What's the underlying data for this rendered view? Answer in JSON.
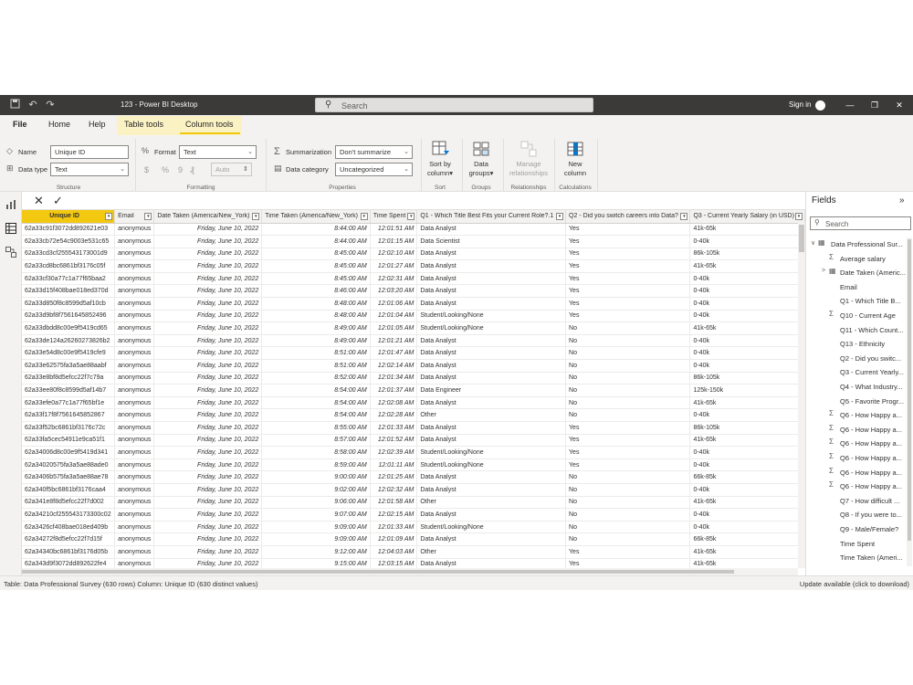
{
  "window": {
    "title": "123 - Power BI Desktop",
    "search_placeholder": "Search",
    "sign_in": "Sign in"
  },
  "menu": {
    "tabs": [
      "File",
      "Home",
      "Help",
      "Table tools",
      "Column tools"
    ],
    "active_tab": "Column tools",
    "accent_color": "#f2c811"
  },
  "ribbon": {
    "structure": {
      "name_label": "Name",
      "name_value": "Unique ID",
      "datatype_label": "Data type",
      "datatype_value": "Text",
      "group": "Structure"
    },
    "formatting": {
      "format_label": "Format",
      "format_value": "Text",
      "symbols": [
        "$",
        "%",
        "9",
        "₰"
      ],
      "auto_value": "Auto",
      "group": "Formatting"
    },
    "properties": {
      "summarization_label": "Summarization",
      "summarization_value": "Don't summarize",
      "category_label": "Data category",
      "category_value": "Uncategorized",
      "group": "Properties"
    },
    "sort": {
      "label": "Sort by column",
      "line1": "Sort by",
      "line2": "column",
      "group": "Sort"
    },
    "groups": {
      "line1": "Data",
      "line2": "groups",
      "group": "Groups"
    },
    "relationships": {
      "line1": "Manage",
      "line2": "relationships",
      "group": "Relationships"
    },
    "calculations": {
      "line1": "New",
      "line2": "column",
      "group": "Calculations"
    }
  },
  "table": {
    "columns": [
      "Unique ID",
      "Email",
      "Date Taken (America/New_York)",
      "Time Taken (America/New_York)",
      "Time Spent",
      "Q1 - Which Title Best Fits your Current Role?.1",
      "Q2 - Did you switch careers into Data?",
      "Q3 - Current Yearly Salary (in USD)"
    ],
    "rows": [
      [
        "62a33c91f3072dd892621e03",
        "anonymous",
        "Friday, June 10, 2022",
        "8:44:00 AM",
        "12:01:51 AM",
        "Data Analyst",
        "Yes",
        "41k-65k"
      ],
      [
        "62a33cb72e54c9003e531c65",
        "anonymous",
        "Friday, June 10, 2022",
        "8:44:00 AM",
        "12:01:15 AM",
        "Data Scientist",
        "Yes",
        "0-40k"
      ],
      [
        "62a33cd3cf255543173001d9",
        "anonymous",
        "Friday, June 10, 2022",
        "8:45:00 AM",
        "12:02:10 AM",
        "Data Analyst",
        "Yes",
        "86k-105k"
      ],
      [
        "62a33cd8bc6861bf3176c05f",
        "anonymous",
        "Friday, June 10, 2022",
        "8:45:00 AM",
        "12:01:27 AM",
        "Data Analyst",
        "Yes",
        "41k-65k"
      ],
      [
        "62a33cf30a77c1a77f65baa2",
        "anonymous",
        "Friday, June 10, 2022",
        "8:45:00 AM",
        "12:02:31 AM",
        "Data Analyst",
        "Yes",
        "0-40k"
      ],
      [
        "62a33d15f408bae018ed370d",
        "anonymous",
        "Friday, June 10, 2022",
        "8:46:00 AM",
        "12:03:20 AM",
        "Data Analyst",
        "Yes",
        "0-40k"
      ],
      [
        "62a33d850f8c8599d5af10cb",
        "anonymous",
        "Friday, June 10, 2022",
        "8:48:00 AM",
        "12:01:06 AM",
        "Data Analyst",
        "Yes",
        "0-40k"
      ],
      [
        "62a33d9bf8f7561645852496",
        "anonymous",
        "Friday, June 10, 2022",
        "8:48:00 AM",
        "12:01:04 AM",
        "Student/Looking/None",
        "Yes",
        "0-40k"
      ],
      [
        "62a33dbdd8c00e9f5419cd65",
        "anonymous",
        "Friday, June 10, 2022",
        "8:49:00 AM",
        "12:01:05 AM",
        "Student/Looking/None",
        "No",
        "41k-65k"
      ],
      [
        "62a33de124a26260273826b2",
        "anonymous",
        "Friday, June 10, 2022",
        "8:49:00 AM",
        "12:01:21 AM",
        "Data Analyst",
        "No",
        "0-40k"
      ],
      [
        "62a33e54d8c00e9f5419cfe9",
        "anonymous",
        "Friday, June 10, 2022",
        "8:51:00 AM",
        "12:01:47 AM",
        "Data Analyst",
        "No",
        "0-40k"
      ],
      [
        "62a33e62575fa3a5ae88aabf",
        "anonymous",
        "Friday, June 10, 2022",
        "8:51:00 AM",
        "12:02:14 AM",
        "Data Analyst",
        "No",
        "0-40k"
      ],
      [
        "62a33e8bf8d5efcc22f7c79a",
        "anonymous",
        "Friday, June 10, 2022",
        "8:52:00 AM",
        "12:01:34 AM",
        "Data Analyst",
        "No",
        "86k-105k"
      ],
      [
        "62a33ee80f8c8599d5af14b7",
        "anonymous",
        "Friday, June 10, 2022",
        "8:54:00 AM",
        "12:01:37 AM",
        "Data Engineer",
        "No",
        "125k-150k"
      ],
      [
        "62a33efe0a77c1a77f65bf1e",
        "anonymous",
        "Friday, June 10, 2022",
        "8:54:00 AM",
        "12:02:08 AM",
        "Data Analyst",
        "No",
        "41k-65k"
      ],
      [
        "62a33f17f8f7561645852867",
        "anonymous",
        "Friday, June 10, 2022",
        "8:54:00 AM",
        "12:02:28 AM",
        "Other",
        "No",
        "0-40k"
      ],
      [
        "62a33f52bc6861bf3176c72c",
        "anonymous",
        "Friday, June 10, 2022",
        "8:55:00 AM",
        "12:01:33 AM",
        "Data Analyst",
        "Yes",
        "86k-105k"
      ],
      [
        "62a33fa5cec54911e9ca51f1",
        "anonymous",
        "Friday, June 10, 2022",
        "8:57:00 AM",
        "12:01:52 AM",
        "Data Analyst",
        "Yes",
        "41k-65k"
      ],
      [
        "62a34006d8c00e9f5419d341",
        "anonymous",
        "Friday, June 10, 2022",
        "8:58:00 AM",
        "12:02:39 AM",
        "Student/Looking/None",
        "Yes",
        "0-40k"
      ],
      [
        "62a34020575fa3a5ae88ade0",
        "anonymous",
        "Friday, June 10, 2022",
        "8:59:00 AM",
        "12:01:11 AM",
        "Student/Looking/None",
        "Yes",
        "0-40k"
      ],
      [
        "62a3406b575fa3a5ae88ae78",
        "anonymous",
        "Friday, June 10, 2022",
        "9:00:00 AM",
        "12:01:25 AM",
        "Data Analyst",
        "No",
        "66k-85k"
      ],
      [
        "62a340f5bc6861bf3176caa4",
        "anonymous",
        "Friday, June 10, 2022",
        "9:02:00 AM",
        "12:02:32 AM",
        "Data Analyst",
        "No",
        "0-40k"
      ],
      [
        "62a341e8f8d5efcc22f7d002",
        "anonymous",
        "Friday, June 10, 2022",
        "9:06:00 AM",
        "12:01:58 AM",
        "Other",
        "No",
        "41k-65k"
      ],
      [
        "62a34210cf255543173300c02",
        "anonymous",
        "Friday, June 10, 2022",
        "9:07:00 AM",
        "12:02:15 AM",
        "Data Analyst",
        "No",
        "0-40k"
      ],
      [
        "62a3426cf408bae018ed409b",
        "anonymous",
        "Friday, June 10, 2022",
        "9:09:00 AM",
        "12:01:33 AM",
        "Student/Looking/None",
        "No",
        "0-40k"
      ],
      [
        "62a34272f8d5efcc22f7d15f",
        "anonymous",
        "Friday, June 10, 2022",
        "9:09:00 AM",
        "12:01:09 AM",
        "Data Analyst",
        "No",
        "66k-85k"
      ],
      [
        "62a34340bc6861bf3176d05b",
        "anonymous",
        "Friday, June 10, 2022",
        "9:12:00 AM",
        "12:04:03 AM",
        "Other",
        "Yes",
        "41k-65k"
      ],
      [
        "62a343d9f3072dd892622fe4",
        "anonymous",
        "Friday, June 10, 2022",
        "9:15:00 AM",
        "12:03:15 AM",
        "Data Analyst",
        "Yes",
        "41k-65k"
      ]
    ]
  },
  "fields": {
    "title": "Fields",
    "search_placeholder": "Search",
    "items": [
      {
        "label": "Data Professional Sur...",
        "icon": "table-icon",
        "level": 0,
        "expander": "∨"
      },
      {
        "label": "Average salary",
        "icon": "sigma-icon",
        "level": 1,
        "expander": ""
      },
      {
        "label": "Date Taken (Americ...",
        "icon": "calendar-icon",
        "level": 1,
        "expander": ">"
      },
      {
        "label": "Email",
        "icon": "",
        "level": 1,
        "expander": ""
      },
      {
        "label": "Q1 - Which Title B...",
        "icon": "",
        "level": 1,
        "expander": ""
      },
      {
        "label": "Q10 - Current Age",
        "icon": "sigma-icon",
        "level": 1,
        "expander": ""
      },
      {
        "label": "Q11 - Which Count...",
        "icon": "",
        "level": 1,
        "expander": ""
      },
      {
        "label": "Q13 - Ethnicity",
        "icon": "",
        "level": 1,
        "expander": ""
      },
      {
        "label": "Q2 - Did you switc...",
        "icon": "",
        "level": 1,
        "expander": ""
      },
      {
        "label": "Q3 - Current Yearly...",
        "icon": "",
        "level": 1,
        "expander": ""
      },
      {
        "label": "Q4 - What Industry...",
        "icon": "",
        "level": 1,
        "expander": ""
      },
      {
        "label": "Q5 - Favorite Progr...",
        "icon": "",
        "level": 1,
        "expander": ""
      },
      {
        "label": "Q6 - How Happy a...",
        "icon": "sigma-icon",
        "level": 1,
        "expander": ""
      },
      {
        "label": "Q6 - How Happy a...",
        "icon": "sigma-icon",
        "level": 1,
        "expander": ""
      },
      {
        "label": "Q6 - How Happy a...",
        "icon": "sigma-icon",
        "level": 1,
        "expander": ""
      },
      {
        "label": "Q6 - How Happy a...",
        "icon": "sigma-icon",
        "level": 1,
        "expander": ""
      },
      {
        "label": "Q6 - How Happy a...",
        "icon": "sigma-icon",
        "level": 1,
        "expander": ""
      },
      {
        "label": "Q6 - How Happy a...",
        "icon": "sigma-icon",
        "level": 1,
        "expander": ""
      },
      {
        "label": "Q7 - How difficult ...",
        "icon": "",
        "level": 1,
        "expander": ""
      },
      {
        "label": "Q8 - If you were to...",
        "icon": "",
        "level": 1,
        "expander": ""
      },
      {
        "label": "Q9 - Male/Female?",
        "icon": "",
        "level": 1,
        "expander": ""
      },
      {
        "label": "Time Spent",
        "icon": "",
        "level": 1,
        "expander": ""
      },
      {
        "label": "Time Taken (Ameri...",
        "icon": "",
        "level": 1,
        "expander": ""
      }
    ]
  },
  "status": {
    "left": "Table: Data Professional Survey (630 rows) Column: Unique ID (630 distinct values)",
    "right": "Update available (click to download)"
  }
}
